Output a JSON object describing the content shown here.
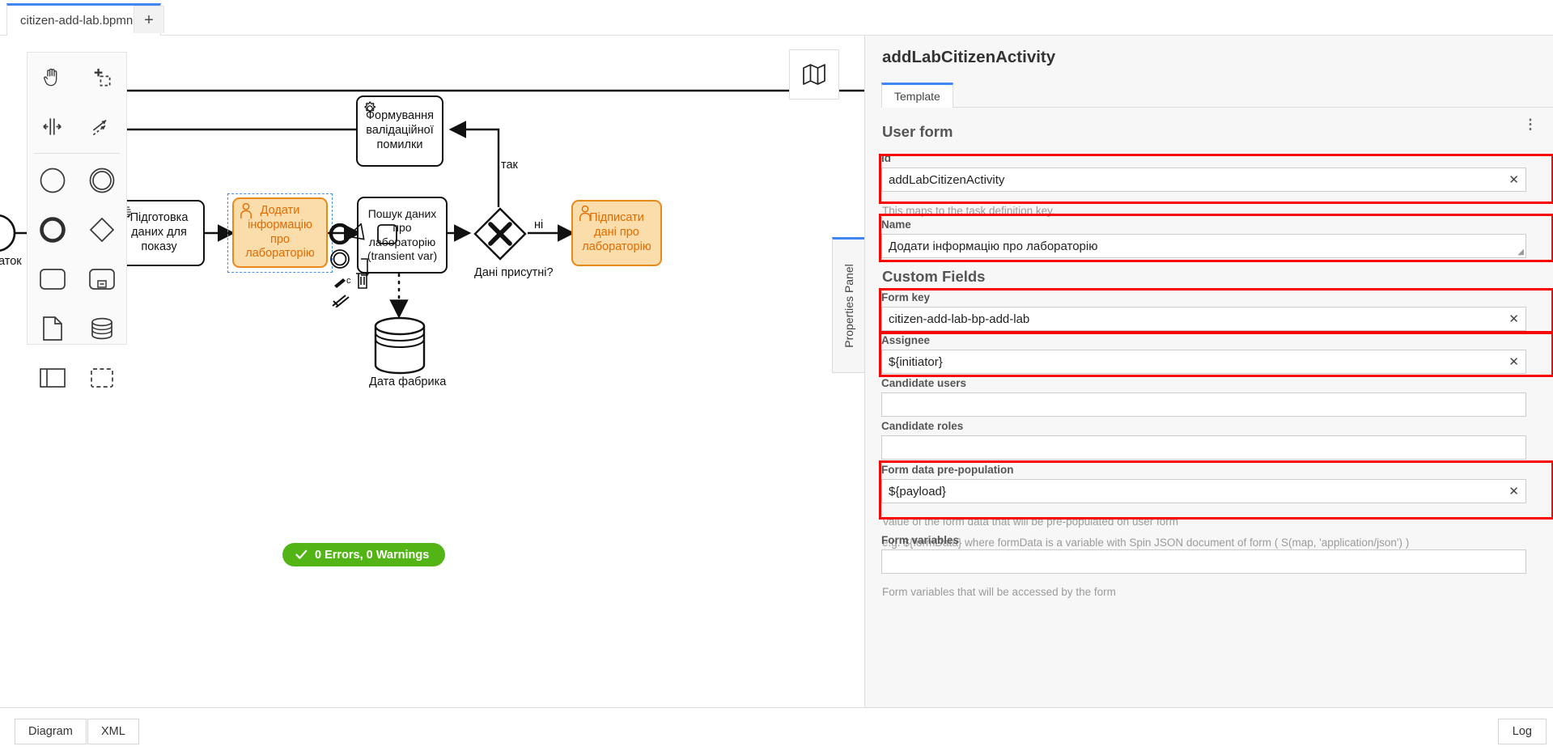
{
  "window": {
    "tab": {
      "filename": "citizen-add-lab.bpmn",
      "dirty_icon": "unsaved-dot-icon"
    },
    "add_tab_label": "+"
  },
  "palette": {
    "tools": [
      "hand-tool-icon",
      "lasso-tool-icon",
      "space-tool-icon",
      "connect-tool-icon"
    ],
    "elements": [
      "start-event-icon",
      "intermediate-event-icon",
      "end-event-icon",
      "gateway-icon",
      "task-icon",
      "subprocess-collapsed-icon",
      "data-object-icon",
      "data-store-icon",
      "participant-icon",
      "group-icon"
    ]
  },
  "canvas": {
    "minimap_icon": "map-icon",
    "tasks": [
      {
        "id": "prep",
        "label": "Підготовка даних для показу",
        "icon": "script-task-icon",
        "type": "script"
      },
      {
        "id": "addlab",
        "label": "Додати інформацію про лабораторію",
        "icon": "user-task-icon",
        "type": "user",
        "selected": true
      },
      {
        "id": "search",
        "label": "Пошук даних про лабораторію (transient var)",
        "icon": "",
        "type": "plain"
      },
      {
        "id": "validation",
        "label": "Формування валідаційної помилки",
        "icon": "service-task-icon",
        "type": "service"
      },
      {
        "id": "sign",
        "label": "Підписати дані про лабораторію",
        "icon": "user-task-icon",
        "type": "user"
      }
    ],
    "gateway_label": "Дані присутні?",
    "flow_labels": {
      "yes": "так",
      "no": "ні"
    },
    "datastore_label": "Дата фабрика",
    "start_event_label": "аток",
    "status": {
      "icon": "check-icon",
      "text": "0 Errors, 0 Warnings",
      "color": "#52b415"
    }
  },
  "bottom_bar": {
    "tabs": [
      "Diagram",
      "XML"
    ],
    "log_label": "Log"
  },
  "properties_tab_label": "Properties Panel",
  "panel": {
    "title": "addLabCitizenActivity",
    "tabs": [
      {
        "label": "Template",
        "active": true
      }
    ],
    "groups": [
      {
        "name": "User form",
        "kebab_icon": "kebab-menu-icon"
      },
      {
        "name": "Custom Fields"
      }
    ],
    "fields": [
      {
        "label": "Id",
        "value": "addLabCitizenActivity",
        "help": "This maps to the task definition key.",
        "clear_icon": "clear-icon",
        "highlighted": true
      },
      {
        "label": "Name",
        "value": "Додати інформацію про лабораторію",
        "help": "",
        "resize_handle": true,
        "highlighted": true
      },
      {
        "label": "Form key",
        "value": "citizen-add-lab-bp-add-lab",
        "help": "",
        "clear_icon": "clear-icon",
        "highlighted": true
      },
      {
        "label": "Assignee",
        "value": "${initiator}",
        "help": "",
        "clear_icon": "clear-icon",
        "highlighted": true
      },
      {
        "label": "Candidate users",
        "value": "",
        "help": "",
        "highlighted": false
      },
      {
        "label": "Candidate roles",
        "value": "",
        "help": "",
        "highlighted": false
      },
      {
        "label": "Form data pre-population",
        "value": "${payload}",
        "help": "Value of the form data that will be pre-populated on user form",
        "help2": "e.g. ${formData} where formData is a variable with Spin JSON document of form ( S(map, 'application/json') )",
        "clear_icon": "clear-icon",
        "highlighted": true
      },
      {
        "label": "Form variables",
        "value": "",
        "help": "Form variables that will be accessed by the form",
        "highlighted": false
      }
    ]
  },
  "colors": {
    "accent": "#4285f4",
    "highlight": "#f60606",
    "task_orange_fill": "#fbdcab",
    "task_orange_stroke": "#e88a1a",
    "task_orange_text": "#e06c00",
    "status_green": "#52b415"
  }
}
